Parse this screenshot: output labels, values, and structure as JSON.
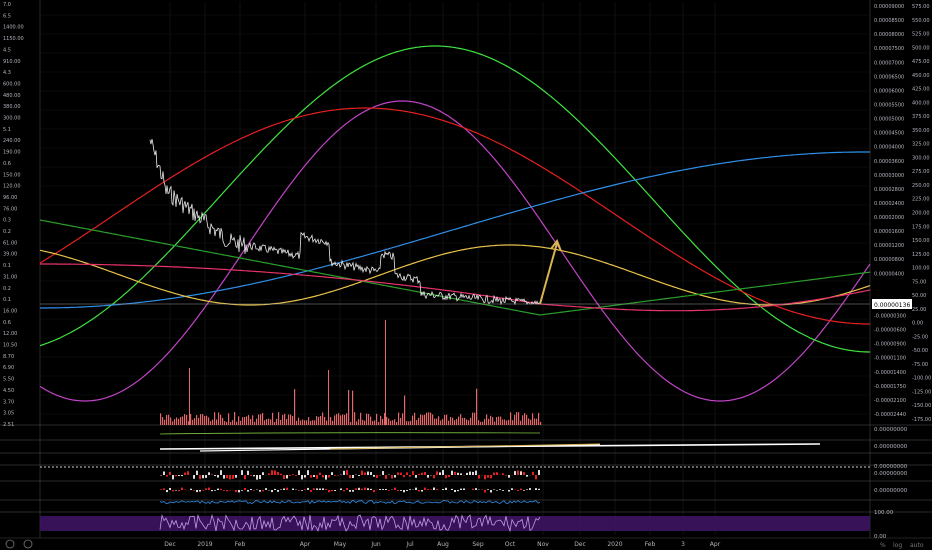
{
  "chart_data": {
    "type": "line",
    "title": "",
    "grid": true,
    "price_ylim": [
      5e-08,
      1.12e-05
    ],
    "price_scale": "log",
    "x_axis": {
      "ticks": [
        "Dec",
        "2019",
        "Feb",
        "Apr",
        "May",
        "Jun",
        "Jul",
        "Aug",
        "Sep",
        "Oct",
        "Nov",
        "Dec",
        "2020",
        "Feb",
        "3",
        "Apr"
      ]
    },
    "left_axis_ticks": [
      "7.0",
      "6.5",
      "1400.00",
      "1150.00",
      "4.5",
      "910.00",
      "4.3",
      "600.00",
      "480.00",
      "380.00",
      "300.00",
      "5.1",
      "240.00",
      "190.00",
      "0.6",
      "150.00",
      "120.00",
      "96.00",
      "76.00",
      "0.3",
      "0.2",
      "61.00",
      "39.00",
      "0.1",
      "31.00",
      "0.2",
      "0.1",
      "16.00",
      "0.6",
      "12.00",
      "10.50",
      "8.70",
      "6.90",
      "5.50",
      "4.50",
      "3.70",
      "3.05",
      "2.51"
    ],
    "right_axis_ticks": [
      "575.00",
      "550.00",
      "525.00",
      "500.00",
      "475.00",
      "450.00",
      "425.00",
      "400.00",
      "375.00",
      "350.00",
      "325.00",
      "300.00",
      "275.00",
      "250.00",
      "225.00",
      "200.00",
      "175.00",
      "150.00",
      "125.00",
      "100.00",
      "75.00",
      "50.00",
      "25.00",
      "0.00",
      "-25.00",
      "-50.00",
      "-75.00",
      "-100.00",
      "-125.00",
      "-150.00",
      "-175.00"
    ],
    "right_price_ticks": [
      "0.00009000",
      "0.00008500",
      "0.00008000",
      "0.00007500",
      "0.00007000",
      "0.00006500",
      "0.00006000",
      "0.00005500",
      "0.00005000",
      "0.00004500",
      "0.00004000",
      "0.00003600",
      "0.00003000",
      "0.00002800",
      "0.00002400",
      "0.00002000",
      "0.00001600",
      "0.00001200",
      "0.00000800",
      "0.00000400",
      "0.00000136",
      "0.00000000",
      "-0.00000300",
      "-0.00000600",
      "-0.00000900",
      "-0.00001100",
      "-0.00001400",
      "-0.00001750",
      "-0.00002100",
      "-0.00002440"
    ],
    "last_price_label": "0.00000136",
    "pane_labels": [
      "0.00000000",
      "0.00000000",
      "0.00000000",
      "0.00000000",
      "0.00000000"
    ],
    "osc_labels": [
      "100.00",
      "0.00"
    ],
    "series": [
      {
        "type": "price",
        "color": "#e8e8e8"
      },
      {
        "type": "curve",
        "color": "#c244c8"
      },
      {
        "type": "curve",
        "color": "#3fe33f"
      },
      {
        "type": "curve",
        "color": "#e52020"
      },
      {
        "type": "curve",
        "color": "#2f8fe8"
      },
      {
        "type": "curve",
        "color": "#e8c24a"
      },
      {
        "type": "curve",
        "color": "#2a9e2a"
      },
      {
        "type": "curve",
        "color": "#e8336b"
      }
    ],
    "colors": {
      "arrow": "#d9b451",
      "volume": "#e26a6a",
      "oscillator": "#c49be8",
      "oscillator_band": "#3d1463",
      "separator": "#8a8a8a"
    }
  },
  "footer": {
    "left_icons": [
      "settings-icon",
      "time-icon"
    ],
    "right_icons": [
      "percent-icon",
      "log-icon",
      "auto-icon"
    ],
    "right_labels": [
      "%",
      "log",
      "auto"
    ]
  }
}
